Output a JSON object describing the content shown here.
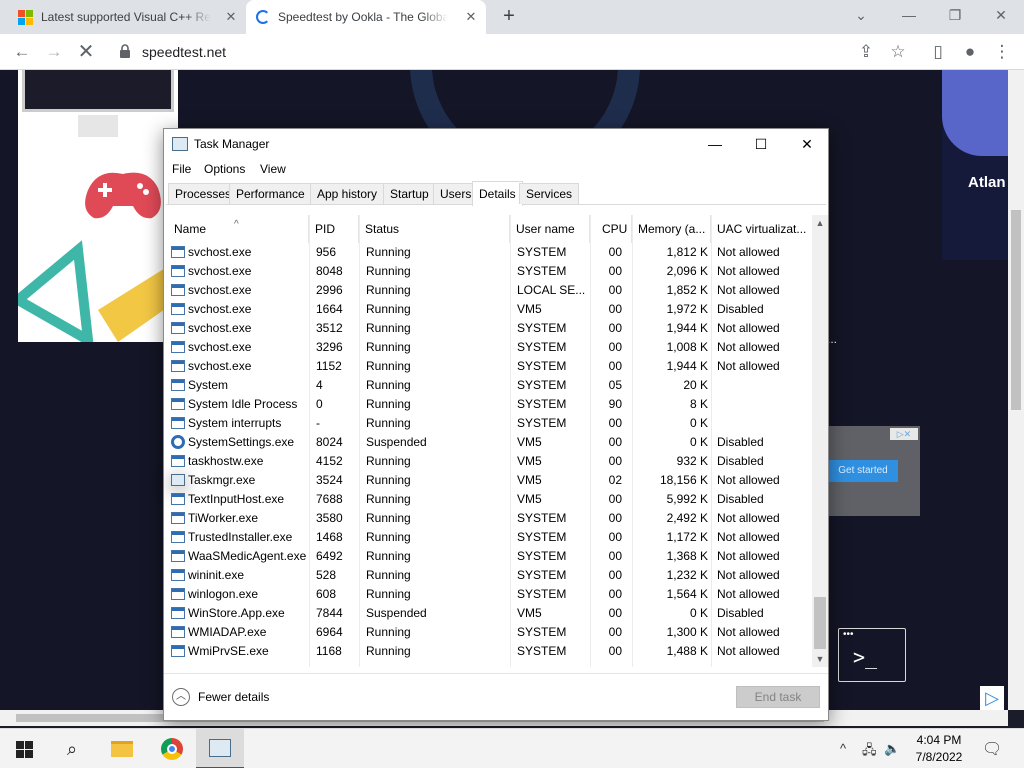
{
  "browser": {
    "tabs": [
      {
        "title": "Latest supported Visual C++ Redistributable",
        "close": "✕"
      },
      {
        "title": "Speedtest by Ookla - The Global Broadband Speed Test",
        "close": "✕"
      }
    ],
    "new_tab": "+",
    "window_controls": {
      "minimize": "⌄",
      "restore": "❐",
      "close": "✕"
    },
    "url": "speedtest.net"
  },
  "page": {
    "ad_right_text": "Atlan",
    "ad_mid_cta": "Get started",
    "ellipsis": "..."
  },
  "task_manager": {
    "title": "Task Manager",
    "window_controls": {
      "minimize": "—",
      "maximize": "☐",
      "close": "✕"
    },
    "menu": [
      "File",
      "Options",
      "View"
    ],
    "tabs": [
      "Processes",
      "Performance",
      "App history",
      "Startup",
      "Users",
      "Details",
      "Services"
    ],
    "active_tab": "Details",
    "columns": {
      "name": "Name",
      "pid": "PID",
      "status": "Status",
      "user": "User name",
      "cpu": "CPU",
      "memory": "Memory (a...",
      "uac": "UAC virtualizat..."
    },
    "rows": [
      {
        "name": "svchost.exe",
        "pid": "956",
        "status": "Running",
        "user": "SYSTEM",
        "cpu": "00",
        "memory": "1,812 K",
        "uac": "Not allowed",
        "icon": "service"
      },
      {
        "name": "svchost.exe",
        "pid": "8048",
        "status": "Running",
        "user": "SYSTEM",
        "cpu": "00",
        "memory": "2,096 K",
        "uac": "Not allowed",
        "icon": "service"
      },
      {
        "name": "svchost.exe",
        "pid": "2996",
        "status": "Running",
        "user": "LOCAL SE...",
        "cpu": "00",
        "memory": "1,852 K",
        "uac": "Not allowed",
        "icon": "service"
      },
      {
        "name": "svchost.exe",
        "pid": "1664",
        "status": "Running",
        "user": "VM5",
        "cpu": "00",
        "memory": "1,972 K",
        "uac": "Disabled",
        "icon": "service"
      },
      {
        "name": "svchost.exe",
        "pid": "3512",
        "status": "Running",
        "user": "SYSTEM",
        "cpu": "00",
        "memory": "1,944 K",
        "uac": "Not allowed",
        "icon": "service"
      },
      {
        "name": "svchost.exe",
        "pid": "3296",
        "status": "Running",
        "user": "SYSTEM",
        "cpu": "00",
        "memory": "1,008 K",
        "uac": "Not allowed",
        "icon": "service"
      },
      {
        "name": "svchost.exe",
        "pid": "1152",
        "status": "Running",
        "user": "SYSTEM",
        "cpu": "00",
        "memory": "1,944 K",
        "uac": "Not allowed",
        "icon": "service"
      },
      {
        "name": "System",
        "pid": "4",
        "status": "Running",
        "user": "SYSTEM",
        "cpu": "05",
        "memory": "20 K",
        "uac": "",
        "icon": "service"
      },
      {
        "name": "System Idle Process",
        "pid": "0",
        "status": "Running",
        "user": "SYSTEM",
        "cpu": "90",
        "memory": "8 K",
        "uac": "",
        "icon": "service"
      },
      {
        "name": "System interrupts",
        "pid": "-",
        "status": "Running",
        "user": "SYSTEM",
        "cpu": "00",
        "memory": "0 K",
        "uac": "",
        "icon": "service"
      },
      {
        "name": "SystemSettings.exe",
        "pid": "8024",
        "status": "Suspended",
        "user": "VM5",
        "cpu": "00",
        "memory": "0 K",
        "uac": "Disabled",
        "icon": "gear"
      },
      {
        "name": "taskhostw.exe",
        "pid": "4152",
        "status": "Running",
        "user": "VM5",
        "cpu": "00",
        "memory": "932 K",
        "uac": "Disabled",
        "icon": "service"
      },
      {
        "name": "Taskmgr.exe",
        "pid": "3524",
        "status": "Running",
        "user": "VM5",
        "cpu": "02",
        "memory": "18,156 K",
        "uac": "Not allowed",
        "icon": "taskmgr"
      },
      {
        "name": "TextInputHost.exe",
        "pid": "7688",
        "status": "Running",
        "user": "VM5",
        "cpu": "00",
        "memory": "5,992 K",
        "uac": "Disabled",
        "icon": "service"
      },
      {
        "name": "TiWorker.exe",
        "pid": "3580",
        "status": "Running",
        "user": "SYSTEM",
        "cpu": "00",
        "memory": "2,492 K",
        "uac": "Not allowed",
        "icon": "service"
      },
      {
        "name": "TrustedInstaller.exe",
        "pid": "1468",
        "status": "Running",
        "user": "SYSTEM",
        "cpu": "00",
        "memory": "1,172 K",
        "uac": "Not allowed",
        "icon": "service"
      },
      {
        "name": "WaaSMedicAgent.exe",
        "pid": "6492",
        "status": "Running",
        "user": "SYSTEM",
        "cpu": "00",
        "memory": "1,368 K",
        "uac": "Not allowed",
        "icon": "service"
      },
      {
        "name": "wininit.exe",
        "pid": "528",
        "status": "Running",
        "user": "SYSTEM",
        "cpu": "00",
        "memory": "1,232 K",
        "uac": "Not allowed",
        "icon": "service"
      },
      {
        "name": "winlogon.exe",
        "pid": "608",
        "status": "Running",
        "user": "SYSTEM",
        "cpu": "00",
        "memory": "1,564 K",
        "uac": "Not allowed",
        "icon": "service"
      },
      {
        "name": "WinStore.App.exe",
        "pid": "7844",
        "status": "Suspended",
        "user": "VM5",
        "cpu": "00",
        "memory": "0 K",
        "uac": "Disabled",
        "icon": "service"
      },
      {
        "name": "WMIADAP.exe",
        "pid": "6964",
        "status": "Running",
        "user": "SYSTEM",
        "cpu": "00",
        "memory": "1,300 K",
        "uac": "Not allowed",
        "icon": "service"
      },
      {
        "name": "WmiPrvSE.exe",
        "pid": "1168",
        "status": "Running",
        "user": "SYSTEM",
        "cpu": "00",
        "memory": "1,488 K",
        "uac": "Not allowed",
        "icon": "service"
      }
    ],
    "fewer_details": "Fewer details",
    "end_task": "End task"
  },
  "taskbar": {
    "time": "4:04 PM",
    "date": "7/8/2022"
  }
}
